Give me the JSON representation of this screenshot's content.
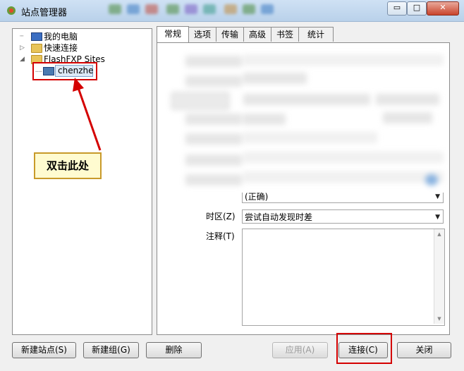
{
  "window": {
    "title": "站点管理器",
    "controls": {
      "minimize": "▭",
      "maximize": "□",
      "close": "✕"
    }
  },
  "tree": {
    "items": [
      {
        "label": "我的电脑",
        "icon": "computer-icon"
      },
      {
        "label": "快速连接",
        "icon": "folder-icon"
      },
      {
        "label": "FlashFXP Sites",
        "icon": "folder-icon"
      },
      {
        "label": "chenzhe",
        "icon": "site-icon"
      }
    ]
  },
  "callout": {
    "text": "双击此处"
  },
  "tabs": [
    {
      "label": "常规",
      "active": true
    },
    {
      "label": "选项"
    },
    {
      "label": "传输"
    },
    {
      "label": "高级"
    },
    {
      "label": "书签"
    },
    {
      "label": "统计"
    }
  ],
  "form": {
    "partial_select": "(正确)",
    "timezone_label": "时区(Z)",
    "timezone_value": "尝试自动发现时差",
    "notes_label": "注释(T)"
  },
  "buttons": {
    "new_site": "新建站点(S)",
    "new_group": "新建组(G)",
    "delete": "删除",
    "apply": "应用(A)",
    "connect": "连接(C)",
    "close": "关闭"
  },
  "colors": {
    "highlight_red": "#d40000",
    "callout_bg": "#fffbd0"
  }
}
